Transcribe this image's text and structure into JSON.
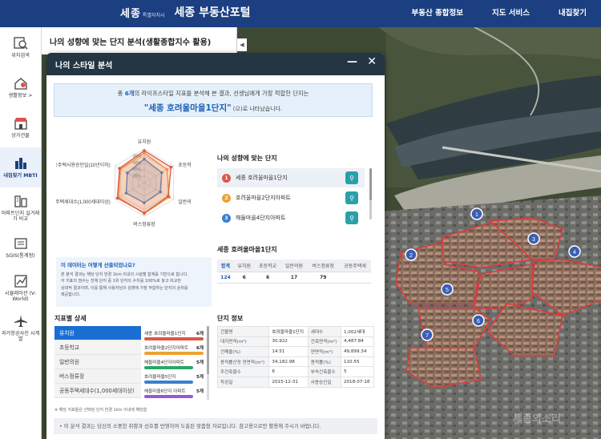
{
  "header": {
    "logo_mark": "세종",
    "logo_sub": "특별자치시",
    "portal_title": "세종 부동산포털",
    "nav": [
      "부동산 종합정보",
      "지도 서비스",
      "내집찾기"
    ]
  },
  "sidebar": {
    "items": [
      {
        "label": "위치검색",
        "icon": "search-map-icon"
      },
      {
        "label": "생활정보 >",
        "icon": "life-info-icon"
      },
      {
        "label": "상가건물",
        "icon": "store-building-icon"
      },
      {
        "label": "내집찾기 MBTI",
        "icon": "building-chart-icon",
        "active": true
      },
      {
        "label": "아파트단지 실거래가 비교",
        "icon": "apartment-icon"
      },
      {
        "label": "SGIS(통계청)",
        "icon": "statistics-icon"
      },
      {
        "label": "시뮬레이션 (V-World)",
        "icon": "simulation-chart-icon"
      },
      {
        "label": "과거항공사진 시계열",
        "icon": "airplane-icon"
      }
    ]
  },
  "top_panel": {
    "title": "나의 성향에 맞는 단지 분석(생활종합지수 활용)",
    "collapse": "◀"
  },
  "modal": {
    "title": "나의 스타일 분석",
    "minimize": "—",
    "close": "✕",
    "summary": {
      "line1_prefix": "총 ",
      "line1_count": "6개",
      "line1_suffix": "의 라이프스타일 지표를 분석해 본 결과, 선생님에게 가장 적합한 단지는",
      "highlight": "\"세종 호려울마을1단지\"",
      "line2_suffix": " (으)로 나타났습니다."
    },
    "radar": {
      "axes": [
        "유치원",
        "초등학교",
        "일반의원",
        "버스정류장",
        "공동주택세대수(1,000세대이상)",
        "공동주택사용승인일(10년이하)"
      ],
      "axis_labels_shown": [
        "유치원",
        "초등학",
        "일반의",
        "버스정류장",
        "공동주택세대수(1,000세대이상)",
        "공동주택사용승인일(10년이하)"
      ],
      "ring_labels": [
        "80%",
        "60%",
        "40%",
        "20%"
      ],
      "series": [
        {
          "color": "#e0564a",
          "values": [
            0.95,
            0.92,
            0.82,
            0.9,
            0.92,
            0.85
          ]
        },
        {
          "color": "#f0a030",
          "values": [
            0.88,
            0.78,
            0.86,
            0.92,
            0.88,
            0.82
          ]
        },
        {
          "color": "#3a7fd0",
          "values": [
            0.7,
            0.6,
            0.55,
            0.6,
            0.62,
            0.58
          ]
        }
      ]
    },
    "info": {
      "title": "이 데이터는 어떻게 산출되었나요?",
      "lines": [
        "본 분석 결과는 해당 단지 반경 1km 이내의 시설별 합계를 기반으로 합니다.",
        "각 지표의 점수는 전체 단지 중 1위 단지의 수치를 100%로 놓고 비교한",
        "상대적 결과이며, 이를 통해 사용자님의 성향에 가장 부합하는 단지의 순위를",
        "제공합니다."
      ]
    },
    "match": {
      "title": "나의 성향에 맞는 단지",
      "items": [
        {
          "num": "1",
          "name": "세종 호려울마을1단지",
          "color": "#e0564a"
        },
        {
          "num": "2",
          "name": "호려울마을2단지아파트",
          "color": "#f0a030"
        },
        {
          "num": "3",
          "name": "해들마을4단지아파트",
          "color": "#3a7fd0"
        }
      ],
      "pin_icon": "map-pin-icon"
    },
    "summary_table": {
      "title": "세종 호려울마을1단지",
      "headers": [
        "합계",
        "유치원",
        "초등학교",
        "일반의원",
        "버스정류장",
        "공동주택세"
      ],
      "values": [
        "124",
        "6",
        "6",
        "17",
        "79",
        ""
      ]
    },
    "detail": {
      "title": "지표별 상세",
      "categories": [
        "유치원",
        "초등학교",
        "일반의원",
        "버스정류장",
        "공동주택세대수(1,000세대이상)"
      ],
      "ranks": [
        {
          "name": "세종 호려울마을1단지",
          "value": "6개",
          "color": "#e0564a",
          "fill": 1.0
        },
        {
          "name": "호려울마을2단지아파트",
          "value": "6개",
          "color": "#f0a030",
          "fill": 1.0
        },
        {
          "name": "해들마을4단지아파트",
          "value": "5개",
          "color": "#2aa866",
          "fill": 0.83
        },
        {
          "name": "호려울마을5단지",
          "value": "5개",
          "color": "#3a7fd0",
          "fill": 0.83
        },
        {
          "name": "해들마을6단지 아파트",
          "value": "5개",
          "color": "#9b59d0",
          "fill": 0.83
        }
      ],
      "note": "※ 해당 지표들은 선택된 단지 반경 1km 이내에 해당함"
    },
    "danji": {
      "title": "단지 정보",
      "rows": [
        [
          "건물명",
          "호려울마을1단지",
          "세대수",
          "1,002세대"
        ],
        [
          "대지면적(m²)",
          "30,922",
          "건축면적(m²)",
          "4,487.84"
        ],
        [
          "건폐율(%)",
          "14.51",
          "연면적(m²)",
          "49,899.34"
        ],
        [
          "용적률산정 연면적(m²)",
          "34,182.98",
          "용적률(%)",
          "110.55"
        ],
        [
          "주건축물수",
          "6",
          "부속건축물수",
          "5"
        ],
        [
          "착공일",
          "2015-12-31",
          "사용승인일",
          "2018-07-18"
        ]
      ]
    },
    "footer_note": "• 이 분석 결과는 당신의 소중한 취향과 선호를 반영하여 도출된 맞춤형 자료입니다. 참고용으로만 활용해 주시기 바랍니다."
  },
  "map": {
    "markers": [
      "1",
      "2",
      "3",
      "4",
      "5",
      "6",
      "7"
    ]
  },
  "watermark": "세종의소리"
}
